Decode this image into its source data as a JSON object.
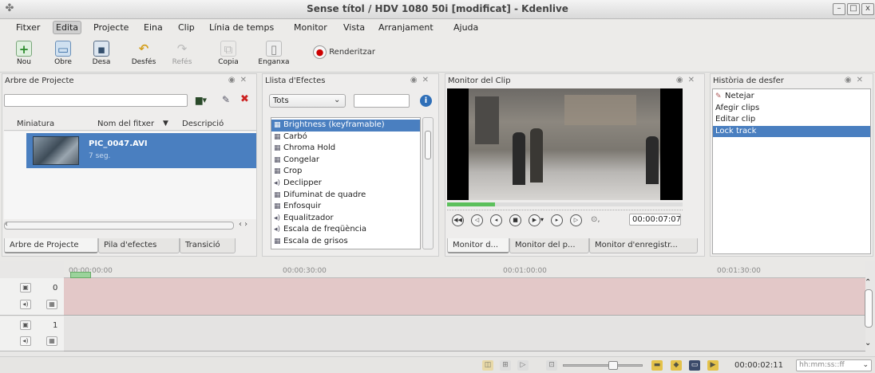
{
  "window": {
    "title": "Sense títol / HDV 1080 50i [modificat] - Kdenlive",
    "app_icon": "kdenlive-icon",
    "controls": [
      "–",
      "□",
      "x"
    ]
  },
  "menubar": [
    "Fitxer",
    "Edita",
    "Projecte",
    "Eina",
    "Clip",
    "Línia de temps",
    "Monitor",
    "Vista",
    "Arranjament",
    "Ajuda"
  ],
  "toolbar": {
    "nou": "Nou",
    "obre": "Obre",
    "desa": "Desa",
    "desfes": "Desfés",
    "refes": "Refés",
    "copia": "Copia",
    "enganxa": "Enganxa",
    "renderitzar": "Renderitzar"
  },
  "project_tree": {
    "title": "Arbre de Projecte",
    "col_thumb": "Miniatura",
    "col_name": "Nom del fitxer",
    "col_desc": "Descripció",
    "clip_name": "PIC_0047.AVI",
    "clip_duration": "7 seg.",
    "tabs": [
      "Arbre de Projecte",
      "Pila d'efectes",
      "Transició"
    ]
  },
  "effects": {
    "title": "Llista d'Efectes",
    "filter": "Tots",
    "items": [
      "Brightness (keyframable)",
      "Carbó",
      "Chroma Hold",
      "Congelar",
      "Crop",
      "Declipper",
      "Difuminat de quadre",
      "Enfosquir",
      "Equalitzador",
      "Escala de freqüència",
      "Escala de grisos"
    ],
    "item_types": [
      "video",
      "video",
      "video",
      "video",
      "video",
      "audio",
      "video",
      "video",
      "audio",
      "audio",
      "video"
    ],
    "selected_index": 0
  },
  "monitor": {
    "title": "Monitor del Clip",
    "timecode": "00:00:07:07",
    "tabs": [
      "Monitor d...",
      "Monitor del p...",
      "Monitor d'enregistr..."
    ]
  },
  "history": {
    "title": "Història de desfer",
    "items": [
      "Netejar",
      "Afegir clips",
      "Editar clip",
      "Lock track"
    ],
    "selected_index": 3
  },
  "timeline": {
    "ruler": [
      "00:00:00:00",
      "00:00:30:00",
      "00:01:00:00",
      "00:01:30:00"
    ],
    "tracks": [
      {
        "num": "0",
        "color": "#e3c8c8"
      },
      {
        "num": "1",
        "color": "#e4e3e2"
      }
    ]
  },
  "statusbar": {
    "timecode": "00:00:02:11",
    "format": "hh:mm:ss::ff"
  },
  "colors": {
    "selection": "#4a7fc0",
    "video_track": "#e3c8c8",
    "audio_track": "#e4e3e2"
  }
}
